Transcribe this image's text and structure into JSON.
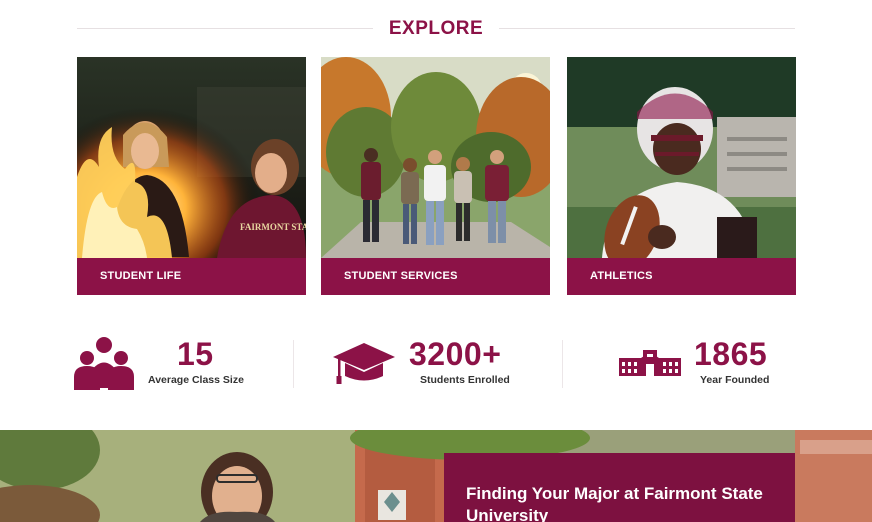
{
  "explore": {
    "title": "EXPLORE"
  },
  "cards": [
    {
      "label": "STUDENT LIFE",
      "sweatshirt_text": "FAIRMONT STATE"
    },
    {
      "label": "STUDENT SERVICES"
    },
    {
      "label": "ATHLETICS"
    }
  ],
  "stats": [
    {
      "value": "15",
      "caption": "Average Class Size",
      "icon": "people-group-icon"
    },
    {
      "value": "3200+",
      "caption": "Students Enrolled",
      "icon": "graduation-cap-icon"
    },
    {
      "value": "1865",
      "caption": "Year Founded",
      "icon": "campus-building-icon"
    }
  ],
  "hero": {
    "title": "Finding Your Major at Fairmont State University"
  },
  "colors": {
    "brand": "#8c1247",
    "panel": "#7d1140"
  }
}
